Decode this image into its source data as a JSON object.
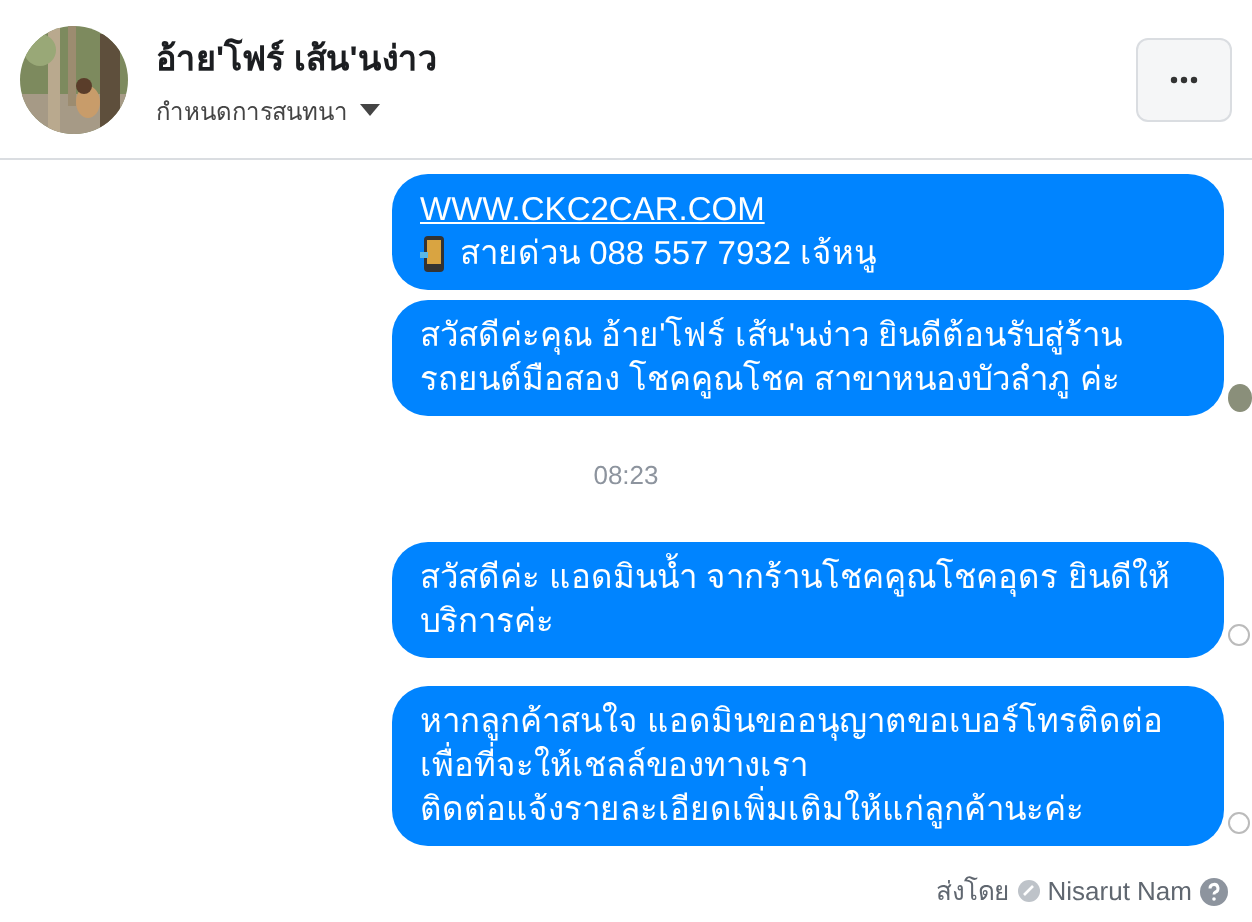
{
  "header": {
    "name": "อ้าย'โฟร์ เส้น'นง่าว",
    "subtitle": "กำหนดการสนทนา"
  },
  "messages": [
    {
      "kind": "plain",
      "lines": [
        {
          "kind": "link",
          "text": "WWW.CKC2CAR.COM"
        },
        {
          "kind": "phone",
          "text": "สายด่วน 088 557 7932 เจ้หนู"
        }
      ]
    },
    {
      "kind": "seen",
      "lines": [
        {
          "kind": "text",
          "text": "สวัสดีค่ะคุณ อ้าย'โฟร์ เส้น'นง่าว ยินดีต้อนรับสู่ร้าน"
        },
        {
          "kind": "text",
          "text": "รถยนต์มือสอง โชคคูณโชค สาขาหนองบัวลำภู ค่ะ"
        }
      ]
    },
    {
      "kind": "time",
      "text": "08:23"
    },
    {
      "kind": "sent",
      "lines": [
        {
          "kind": "text",
          "text": "สวัสดีค่ะ แอดมินน้ำ จากร้านโชคคูณโชคอุดร ยินดีให้"
        },
        {
          "kind": "text",
          "text": "บริการค่ะ"
        }
      ]
    },
    {
      "kind": "sent",
      "lines": [
        {
          "kind": "text",
          "text": "หากลูกค้าสนใจ แอดมินขออนุญาตขอเบอร์โทรติดต่อ"
        },
        {
          "kind": "text",
          "text": "เพื่อที่จะให้เชลล์ของทางเรา"
        },
        {
          "kind": "text",
          "text": "ติดต่อแจ้งรายละเอียดเพิ่มเติมให้แก่ลูกค้านะค่ะ"
        }
      ]
    }
  ],
  "footer": {
    "label": "ส่งโดย",
    "sender": "Nisarut Nam"
  }
}
